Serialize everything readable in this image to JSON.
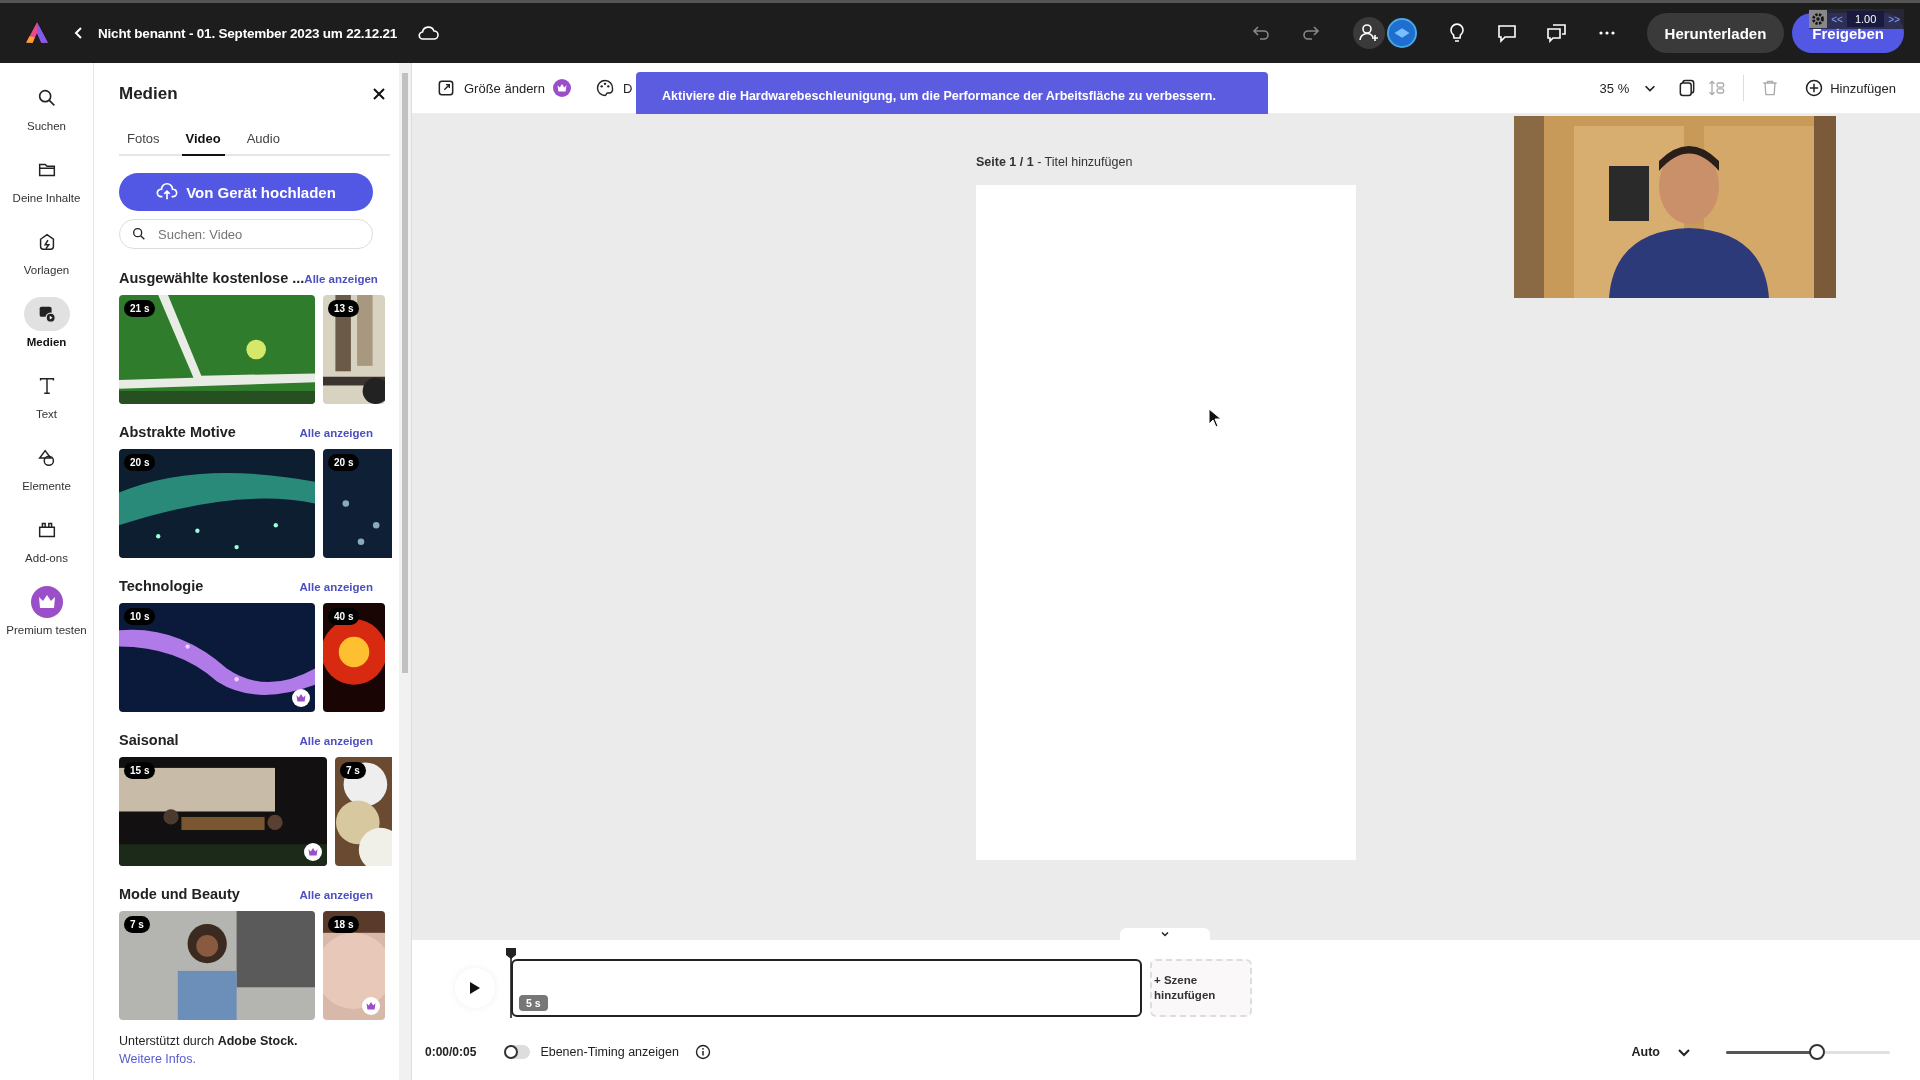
{
  "top_bar": {
    "title": "Nicht benannt - 01. September 2023 um 22.12.21",
    "buttons": [
      "Herunterladen",
      "Freigeben"
    ]
  },
  "speed_overlay": {
    "back": "<<",
    "value": "1.00",
    "forward": ">>"
  },
  "rail": [
    {
      "label": "Suchen",
      "selected": false,
      "kind": "search"
    },
    {
      "label": "Deine Inhalte",
      "selected": false,
      "kind": "folder"
    },
    {
      "label": "Vorlagen",
      "selected": false,
      "kind": "templates"
    },
    {
      "label": "Medien",
      "selected": true,
      "kind": "media"
    },
    {
      "label": "Text",
      "selected": false,
      "kind": "text"
    },
    {
      "label": "Elemente",
      "selected": false,
      "kind": "shapes"
    },
    {
      "label": "Add-ons",
      "selected": false,
      "kind": "addons"
    },
    {
      "label": "Premium testen",
      "selected": false,
      "kind": "premium"
    }
  ],
  "panel": {
    "title": "Medien",
    "tabs": [
      {
        "label": "Fotos",
        "selected": false
      },
      {
        "label": "Video",
        "selected": true
      },
      {
        "label": "Audio",
        "selected": false
      }
    ],
    "upload_button": "Von Gerät hochladen",
    "search": {
      "placeholder": "Suchen: Video"
    },
    "sections": [
      {
        "title": "Ausgewählte kostenlose ...",
        "link": "Alle anzeigen",
        "items": [
          {
            "duration": "21 s",
            "premium": false
          },
          {
            "duration": "13 s",
            "premium": false
          }
        ]
      },
      {
        "title": "Abstrakte Motive",
        "link": "Alle anzeigen",
        "items": [
          {
            "duration": "20 s",
            "premium": false
          },
          {
            "duration": "20 s",
            "premium": false
          }
        ]
      },
      {
        "title": "Technologie",
        "link": "Alle anzeigen",
        "items": [
          {
            "duration": "10 s",
            "premium": true
          },
          {
            "duration": "40 s",
            "premium": false
          }
        ]
      },
      {
        "title": "Saisonal",
        "link": "Alle anzeigen",
        "items": [
          {
            "duration": "15 s",
            "premium": true
          },
          {
            "duration": "7 s",
            "premium": false
          }
        ]
      },
      {
        "title": "Mode und Beauty",
        "link": "Alle anzeigen",
        "items": [
          {
            "duration": "7 s",
            "premium": false
          },
          {
            "duration": "18 s",
            "premium": true
          }
        ]
      }
    ],
    "footer": "Unterstützt durch **Adobe Stock.**",
    "footer_link": "Weitere Infos."
  },
  "toolbar": {
    "items": [
      {
        "label": "Größe ändern",
        "premium": true,
        "kind": "resize"
      },
      {
        "label": "D",
        "kind": "palette"
      }
    ],
    "zoom": "35 %",
    "add": "Hinzufügen"
  },
  "toast": {
    "message": "Aktiviere die Hardwarebeschleunigung, um die Performance der Arbeitsfläche zu verbessern."
  },
  "page": {
    "label": "**Seite 1 / 1** - Titel hinzufügen"
  },
  "timeline": {
    "scene_duration": "5 s",
    "add_scene": "+ Szene hinzufügen",
    "time": "0:00/0:05",
    "layer_timing": {
      "label": "Ebenen-Timing anzeigen",
      "on": false
    },
    "zoom_mode": "Auto",
    "level": 0.55
  }
}
